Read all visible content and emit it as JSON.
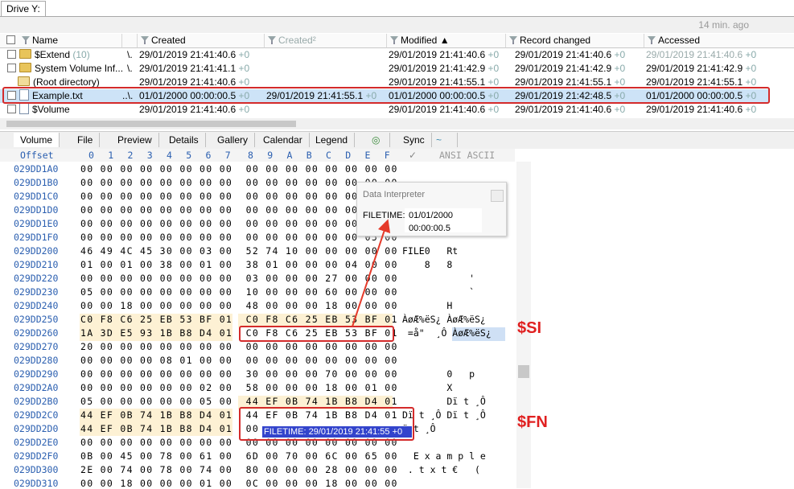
{
  "window": {
    "drive_tab": "Drive Y:",
    "updated": "14 min. ago"
  },
  "columns": [
    {
      "label": "Name"
    },
    {
      "label": "Created"
    },
    {
      "label": "Created²"
    },
    {
      "label": "Modified"
    },
    {
      "label": "Record changed"
    },
    {
      "label": "Accessed"
    }
  ],
  "files": [
    {
      "name": "$Extend",
      "count": "(10)",
      "ext": "\\.",
      "created": "29/01/2019  21:41:40.6",
      "created_tz": "+0",
      "created2": "",
      "created2_tz": "",
      "modified": "29/01/2019  21:41:40.6",
      "modified_tz": "+0",
      "record": "29/01/2019  21:41:40.6",
      "record_tz": "+0",
      "accessed": "29/01/2019  21:41:40.6",
      "accessed_tz": "+0",
      "icon": "folder-icon"
    },
    {
      "name": "System Volume Inf...",
      "count": "",
      "ext": "\\.",
      "created": "29/01/2019  21:41:41.1",
      "created_tz": "+0",
      "created2": "",
      "created2_tz": "",
      "modified": "29/01/2019  21:41:42.9",
      "modified_tz": "+0",
      "record": "29/01/2019  21:41:42.9",
      "record_tz": "+0",
      "accessed": "29/01/2019  21:41:42.9",
      "accessed_tz": "+0",
      "icon": "folder-icon"
    },
    {
      "name": "(Root directory)",
      "count": "",
      "ext": "",
      "created": "29/01/2019  21:41:40.6",
      "created_tz": "+0",
      "created2": "",
      "created2_tz": "",
      "modified": "29/01/2019  21:41:55.1",
      "modified_tz": "+0",
      "record": "29/01/2019  21:41:55.1",
      "record_tz": "+0",
      "accessed": "29/01/2019  21:41:55.1",
      "accessed_tz": "+0",
      "icon": "folder-icon"
    },
    {
      "name": "Example.txt",
      "count": "",
      "ext": "..\\.",
      "created": "01/01/2000  00:00:00.5",
      "created_tz": "+0",
      "created2": "29/01/2019  21:41:55.1",
      "created2_tz": "+0",
      "modified": "01/01/2000  00:00:00.5",
      "modified_tz": "+0",
      "record": "29/01/2019  21:42:48.5",
      "record_tz": "+0",
      "accessed": "01/01/2000  00:00:00.5",
      "accessed_tz": "+0",
      "icon": "document-icon"
    },
    {
      "name": "$Volume",
      "count": "",
      "ext": "",
      "created": "29/01/2019  21:41:40.6",
      "created_tz": "+0",
      "created2": "",
      "created2_tz": "",
      "modified": "29/01/2019  21:41:40.6",
      "modified_tz": "+0",
      "record": "29/01/2019  21:41:40.6",
      "record_tz": "+0",
      "accessed": "29/01/2019  21:41:40.6",
      "accessed_tz": "+0",
      "icon": "document-icon"
    }
  ],
  "tabs": [
    "Volume",
    "File",
    "Preview",
    "Details",
    "Gallery",
    "Calendar",
    "Legend",
    "Sync"
  ],
  "hex": {
    "offset_label": "Offset",
    "columns": [
      "0",
      "1",
      "2",
      "3",
      "4",
      "5",
      "6",
      "7",
      "8",
      "9",
      "A",
      "B",
      "C",
      "D",
      "E",
      "F"
    ],
    "ansi_label": "ANSI ASCII",
    "rows": [
      {
        "offset": "029DD1A0",
        "bytes": "00 00 00 00 00 00 00 00  00 00 00 00 00 00 00 00",
        "ansi": ""
      },
      {
        "offset": "029DD1B0",
        "bytes": "00 00 00 00 00 00 00 00  00 00 00 00 00 00 00 00",
        "ansi": ""
      },
      {
        "offset": "029DD1C0",
        "bytes": "00 00 00 00 00 00 00 00  00 00 00 00 00 00 00 00",
        "ansi": ""
      },
      {
        "offset": "029DD1D0",
        "bytes": "00 00 00 00 00 00 00 00  00 00 00 00 00 00 00 00",
        "ansi": ""
      },
      {
        "offset": "029DD1E0",
        "bytes": "00 00 00 00 00 00 00 00  00 00 00 00 00 00 00 00",
        "ansi": ""
      },
      {
        "offset": "029DD1F0",
        "bytes": "00 00 00 00 00 00 00 00  00 00 00 00 00 00 05 00",
        "ansi": ""
      },
      {
        "offset": "029DD200",
        "bytes": "46 49 4C 45 30 00 03 00  52 74 10 00 00 00 00 00",
        "ansi": "FILE0   Rt"
      },
      {
        "offset": "029DD210",
        "bytes": "01 00 01 00 38 00 01 00  38 01 00 00 00 04 00 00",
        "ansi": "    8   8"
      },
      {
        "offset": "029DD220",
        "bytes": "00 00 00 00 00 00 00 00  03 00 00 00 27 00 00 00",
        "ansi": "            '"
      },
      {
        "offset": "029DD230",
        "bytes": "05 00 00 00 00 00 00 00  10 00 00 00 60 00 00 00",
        "ansi": "            `"
      },
      {
        "offset": "029DD240",
        "bytes": "00 00 18 00 00 00 00 00  48 00 00 00 18 00 00 00",
        "ansi": "        H"
      },
      {
        "offset": "029DD250",
        "bytes": "C0 F8 C6 25 EB 53 BF 01  C0 F8 C6 25 EB 53 BF 01",
        "ansi": "ÀøÆ%ëS¿ ÀøÆ%ëS¿"
      },
      {
        "offset": "029DD260",
        "bytes": "1A 3D E5 93 1B B8 D4 01  C0 F8 C6 25 EB 53 BF 01",
        "ansi": " =å\"  ¸Ô ÀøÆ%ëS¿"
      },
      {
        "offset": "029DD270",
        "bytes": "20 00 00 00 00 00 00 00  00 00 00 00 00 00 00 00",
        "ansi": ""
      },
      {
        "offset": "029DD280",
        "bytes": "00 00 00 00 08 01 00 00  00 00 00 00 00 00 00 00",
        "ansi": ""
      },
      {
        "offset": "029DD290",
        "bytes": "00 00 00 00 00 00 00 00  30 00 00 00 70 00 00 00",
        "ansi": "        0   p"
      },
      {
        "offset": "029DD2A0",
        "bytes": "00 00 00 00 00 00 02 00  58 00 00 00 18 00 01 00",
        "ansi": "        X"
      },
      {
        "offset": "029DD2B0",
        "bytes": "05 00 00 00 00 00 05 00  44 EF 0B 74 1B B8 D4 01",
        "ansi": "        Dï t ¸Ô"
      },
      {
        "offset": "029DD2C0",
        "bytes": "44 EF 0B 74 1B B8 D4 01  44 EF 0B 74 1B B8 D4 01",
        "ansi": "Dï t ¸Ô Dï t ¸Ô"
      },
      {
        "offset": "029DD2D0",
        "bytes": "44 EF 0B 74 1B B8 D4 01  00",
        "ansi": "ï t ¸Ô"
      },
      {
        "offset": "029DD2E0",
        "bytes": "00 00 00 00 00 00 00 00  00 00 00 00 00 00 00 00",
        "ansi": ""
      },
      {
        "offset": "029DD2F0",
        "bytes": "0B 00 45 00 78 00 61 00  6D 00 70 00 6C 00 65 00",
        "ansi": "  E x a m p l e"
      },
      {
        "offset": "029DD300",
        "bytes": "2E 00 74 00 78 00 74 00  80 00 00 00 28 00 00 00",
        "ansi": " . t x t €   ("
      },
      {
        "offset": "029DD310",
        "bytes": "00 00 18 00 00 00 01 00  0C 00 00 00 18 00 00 00",
        "ansi": ""
      }
    ]
  },
  "interpreter": {
    "title": "Data Interpreter",
    "label": "FILETIME:",
    "value_date": "01/01/2000",
    "value_time": "00:00:00.5"
  },
  "annotations": {
    "si": "$SI",
    "fn": "$FN"
  },
  "tooltip": "FILETIME: 29/01/2019  21:41:55  +0",
  "colors": {
    "highlight": "#d42b2b",
    "offset_blue": "#2b5fb0",
    "selection": "#cde3f7",
    "tooltip_bg": "#3344cc"
  }
}
